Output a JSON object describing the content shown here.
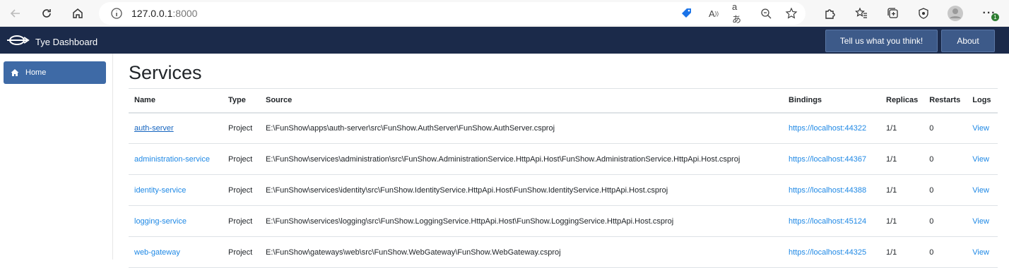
{
  "browser": {
    "url_host": "127.0.0.1",
    "url_port": ":8000",
    "notification_badge": "1"
  },
  "navbar": {
    "brand": "Tye Dashboard",
    "feedback_button": "Tell us what you think!",
    "about_button": "About"
  },
  "sidebar": {
    "items": [
      {
        "label": "Home",
        "icon": "home-icon",
        "active": true
      }
    ]
  },
  "main": {
    "title": "Services",
    "columns": [
      "Name",
      "Type",
      "Source",
      "Bindings",
      "Replicas",
      "Restarts",
      "Logs"
    ],
    "rows": [
      {
        "name": "auth-server",
        "type": "Project",
        "source": "E:\\FunShow\\apps\\auth-server\\src\\FunShow.AuthServer\\FunShow.AuthServer.csproj",
        "binding": "https://localhost:44322",
        "replicas": "1/1",
        "restarts": "0",
        "logs": "View"
      },
      {
        "name": "administration-service",
        "type": "Project",
        "source": "E:\\FunShow\\services\\administration\\src\\FunShow.AdministrationService.HttpApi.Host\\FunShow.AdministrationService.HttpApi.Host.csproj",
        "binding": "https://localhost:44367",
        "replicas": "1/1",
        "restarts": "0",
        "logs": "View"
      },
      {
        "name": "identity-service",
        "type": "Project",
        "source": "E:\\FunShow\\services\\identity\\src\\FunShow.IdentityService.HttpApi.Host\\FunShow.IdentityService.HttpApi.Host.csproj",
        "binding": "https://localhost:44388",
        "replicas": "1/1",
        "restarts": "0",
        "logs": "View"
      },
      {
        "name": "logging-service",
        "type": "Project",
        "source": "E:\\FunShow\\services\\logging\\src\\FunShow.LoggingService.HttpApi.Host\\FunShow.LoggingService.HttpApi.Host.csproj",
        "binding": "https://localhost:45124",
        "replicas": "1/1",
        "restarts": "0",
        "logs": "View"
      },
      {
        "name": "web-gateway",
        "type": "Project",
        "source": "E:\\FunShow\\gateways\\web\\src\\FunShow.WebGateway\\FunShow.WebGateway.csproj",
        "binding": "https://localhost:44325",
        "replicas": "1/1",
        "restarts": "0",
        "logs": "View"
      }
    ]
  },
  "colors": {
    "navbar_bg": "#1b2a4a",
    "nav_button_bg": "#3d5a89",
    "sidebar_active": "#3e6aa6",
    "link": "#1e88e5"
  }
}
